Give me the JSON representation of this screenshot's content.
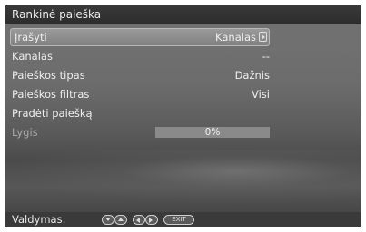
{
  "window": {
    "title": "Rankinė paieška"
  },
  "menu": [
    {
      "label": "Įrašyti",
      "value": "Kanalas"
    },
    {
      "label": "Kanalas",
      "value": "--"
    },
    {
      "label": "Paieškos tipas",
      "value": "Dažnis"
    },
    {
      "label": "Paieškos filtras",
      "value": "Visi"
    },
    {
      "label": "Pradėti paiešką",
      "value": ""
    },
    {
      "label": "Lygis",
      "value": "0%"
    }
  ],
  "level": {
    "percent": 0
  },
  "footer": {
    "label": "Valdymas:",
    "exit": "EXIT"
  },
  "icons": [
    "up-arrow-icon",
    "down-arrow-icon",
    "left-arrow-icon",
    "right-arrow-icon",
    "exit-button"
  ]
}
